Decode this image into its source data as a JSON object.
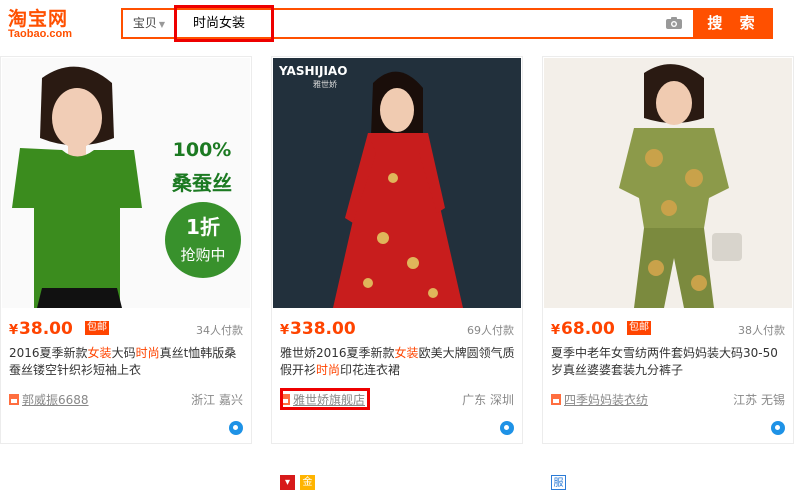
{
  "header": {
    "logo_main": "淘宝网",
    "logo_sub": "Taobao.com",
    "search_tab": "宝贝",
    "query": "时尚女装",
    "search_button": "搜 索"
  },
  "products": [
    {
      "image_text": {
        "line1": "100%",
        "line2": "桑蚕丝",
        "badge_1": "1折",
        "badge_2": "抢购中"
      },
      "price_symbol": "¥",
      "price": "38.00",
      "free_shipping": "包邮",
      "deals": "34人付款",
      "title_a": "2016夏季新款",
      "title_b": "女装",
      "title_c": "大码",
      "title_d": "时尚",
      "title_e": "真丝t恤韩版桑蚕丝镂空针织衫短袖上衣",
      "shop": "郭威振6688",
      "location": "浙江 嘉兴"
    },
    {
      "image_text": {
        "brand": "YASHIJIAO",
        "brand_cn": "雅世娇"
      },
      "price_symbol": "¥",
      "price": "338.00",
      "deals": "69人付款",
      "title_a": "雅世娇2016夏季新款",
      "title_b": "女装",
      "title_c": "欧美大牌圆领气质假开衫",
      "title_d": "时尚",
      "title_e": "印花连衣裙",
      "shop": "雅世娇旗舰店",
      "location": "广东 深圳",
      "badge_gold": "金"
    },
    {
      "price_symbol": "¥",
      "price": "68.00",
      "free_shipping": "包邮",
      "deals": "38人付款",
      "title": "夏季中老年女雪纺两件套妈妈装大码30-50岁真丝婆婆套装九分裤子",
      "shop": "四季妈妈装衣纺",
      "location": "江苏 无锡",
      "badge_fu": "服"
    }
  ],
  "colors": {
    "brand_orange": "#ff5000",
    "price": "#ff4400",
    "highlight_box": "#e00000"
  }
}
